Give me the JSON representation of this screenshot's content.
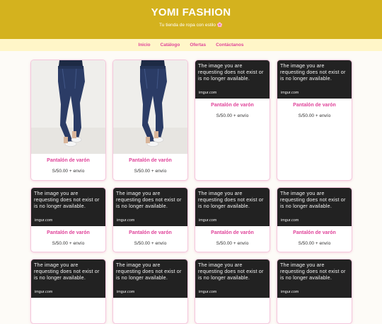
{
  "header": {
    "title": "YOMI FASHION",
    "tagline": "Tu tienda de ropa con estilo 🌸"
  },
  "nav": [
    {
      "label": "Inicio"
    },
    {
      "label": "Catálogo"
    },
    {
      "label": "Ofertas"
    },
    {
      "label": "Contáctanos"
    }
  ],
  "missing_image": {
    "message": "The image you are requesting does not exist or is no longer available.",
    "source": "imgur.com"
  },
  "products": [
    {
      "name": "Pantalón de varón",
      "price": "S/50.00 + envío",
      "image": "photo"
    },
    {
      "name": "Pantalón de varón",
      "price": "S/50.00 + envío",
      "image": "photo"
    },
    {
      "name": "Pantalón de varón",
      "price": "S/50.00 + envío",
      "image": "missing"
    },
    {
      "name": "Pantalón de varón",
      "price": "S/50.00 + envío",
      "image": "missing"
    },
    {
      "name": "Pantalón de varón",
      "price": "S/50.00 + envío",
      "image": "missing"
    },
    {
      "name": "Pantalón de varón",
      "price": "S/50.00 + envío",
      "image": "missing"
    },
    {
      "name": "Pantalón de varón",
      "price": "S/50.00 + envío",
      "image": "missing"
    },
    {
      "name": "Pantalón de varón",
      "price": "S/50.00 + envío",
      "image": "missing"
    },
    {
      "name": "",
      "price": "",
      "image": "missing"
    },
    {
      "name": "",
      "price": "",
      "image": "missing"
    },
    {
      "name": "",
      "price": "",
      "image": "missing"
    },
    {
      "name": "",
      "price": "",
      "image": "missing"
    }
  ]
}
